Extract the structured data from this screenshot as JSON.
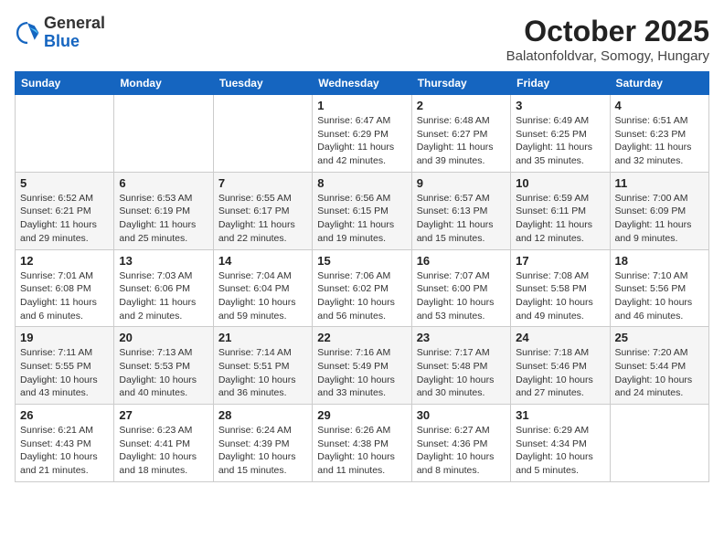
{
  "logo": {
    "general": "General",
    "blue": "Blue"
  },
  "header": {
    "month": "October 2025",
    "location": "Balatonfoldvar, Somogy, Hungary"
  },
  "weekdays": [
    "Sunday",
    "Monday",
    "Tuesday",
    "Wednesday",
    "Thursday",
    "Friday",
    "Saturday"
  ],
  "weeks": [
    [
      {
        "day": "",
        "info": ""
      },
      {
        "day": "",
        "info": ""
      },
      {
        "day": "",
        "info": ""
      },
      {
        "day": "1",
        "info": "Sunrise: 6:47 AM\nSunset: 6:29 PM\nDaylight: 11 hours and 42 minutes."
      },
      {
        "day": "2",
        "info": "Sunrise: 6:48 AM\nSunset: 6:27 PM\nDaylight: 11 hours and 39 minutes."
      },
      {
        "day": "3",
        "info": "Sunrise: 6:49 AM\nSunset: 6:25 PM\nDaylight: 11 hours and 35 minutes."
      },
      {
        "day": "4",
        "info": "Sunrise: 6:51 AM\nSunset: 6:23 PM\nDaylight: 11 hours and 32 minutes."
      }
    ],
    [
      {
        "day": "5",
        "info": "Sunrise: 6:52 AM\nSunset: 6:21 PM\nDaylight: 11 hours and 29 minutes."
      },
      {
        "day": "6",
        "info": "Sunrise: 6:53 AM\nSunset: 6:19 PM\nDaylight: 11 hours and 25 minutes."
      },
      {
        "day": "7",
        "info": "Sunrise: 6:55 AM\nSunset: 6:17 PM\nDaylight: 11 hours and 22 minutes."
      },
      {
        "day": "8",
        "info": "Sunrise: 6:56 AM\nSunset: 6:15 PM\nDaylight: 11 hours and 19 minutes."
      },
      {
        "day": "9",
        "info": "Sunrise: 6:57 AM\nSunset: 6:13 PM\nDaylight: 11 hours and 15 minutes."
      },
      {
        "day": "10",
        "info": "Sunrise: 6:59 AM\nSunset: 6:11 PM\nDaylight: 11 hours and 12 minutes."
      },
      {
        "day": "11",
        "info": "Sunrise: 7:00 AM\nSunset: 6:09 PM\nDaylight: 11 hours and 9 minutes."
      }
    ],
    [
      {
        "day": "12",
        "info": "Sunrise: 7:01 AM\nSunset: 6:08 PM\nDaylight: 11 hours and 6 minutes."
      },
      {
        "day": "13",
        "info": "Sunrise: 7:03 AM\nSunset: 6:06 PM\nDaylight: 11 hours and 2 minutes."
      },
      {
        "day": "14",
        "info": "Sunrise: 7:04 AM\nSunset: 6:04 PM\nDaylight: 10 hours and 59 minutes."
      },
      {
        "day": "15",
        "info": "Sunrise: 7:06 AM\nSunset: 6:02 PM\nDaylight: 10 hours and 56 minutes."
      },
      {
        "day": "16",
        "info": "Sunrise: 7:07 AM\nSunset: 6:00 PM\nDaylight: 10 hours and 53 minutes."
      },
      {
        "day": "17",
        "info": "Sunrise: 7:08 AM\nSunset: 5:58 PM\nDaylight: 10 hours and 49 minutes."
      },
      {
        "day": "18",
        "info": "Sunrise: 7:10 AM\nSunset: 5:56 PM\nDaylight: 10 hours and 46 minutes."
      }
    ],
    [
      {
        "day": "19",
        "info": "Sunrise: 7:11 AM\nSunset: 5:55 PM\nDaylight: 10 hours and 43 minutes."
      },
      {
        "day": "20",
        "info": "Sunrise: 7:13 AM\nSunset: 5:53 PM\nDaylight: 10 hours and 40 minutes."
      },
      {
        "day": "21",
        "info": "Sunrise: 7:14 AM\nSunset: 5:51 PM\nDaylight: 10 hours and 36 minutes."
      },
      {
        "day": "22",
        "info": "Sunrise: 7:16 AM\nSunset: 5:49 PM\nDaylight: 10 hours and 33 minutes."
      },
      {
        "day": "23",
        "info": "Sunrise: 7:17 AM\nSunset: 5:48 PM\nDaylight: 10 hours and 30 minutes."
      },
      {
        "day": "24",
        "info": "Sunrise: 7:18 AM\nSunset: 5:46 PM\nDaylight: 10 hours and 27 minutes."
      },
      {
        "day": "25",
        "info": "Sunrise: 7:20 AM\nSunset: 5:44 PM\nDaylight: 10 hours and 24 minutes."
      }
    ],
    [
      {
        "day": "26",
        "info": "Sunrise: 6:21 AM\nSunset: 4:43 PM\nDaylight: 10 hours and 21 minutes."
      },
      {
        "day": "27",
        "info": "Sunrise: 6:23 AM\nSunset: 4:41 PM\nDaylight: 10 hours and 18 minutes."
      },
      {
        "day": "28",
        "info": "Sunrise: 6:24 AM\nSunset: 4:39 PM\nDaylight: 10 hours and 15 minutes."
      },
      {
        "day": "29",
        "info": "Sunrise: 6:26 AM\nSunset: 4:38 PM\nDaylight: 10 hours and 11 minutes."
      },
      {
        "day": "30",
        "info": "Sunrise: 6:27 AM\nSunset: 4:36 PM\nDaylight: 10 hours and 8 minutes."
      },
      {
        "day": "31",
        "info": "Sunrise: 6:29 AM\nSunset: 4:34 PM\nDaylight: 10 hours and 5 minutes."
      },
      {
        "day": "",
        "info": ""
      }
    ]
  ]
}
